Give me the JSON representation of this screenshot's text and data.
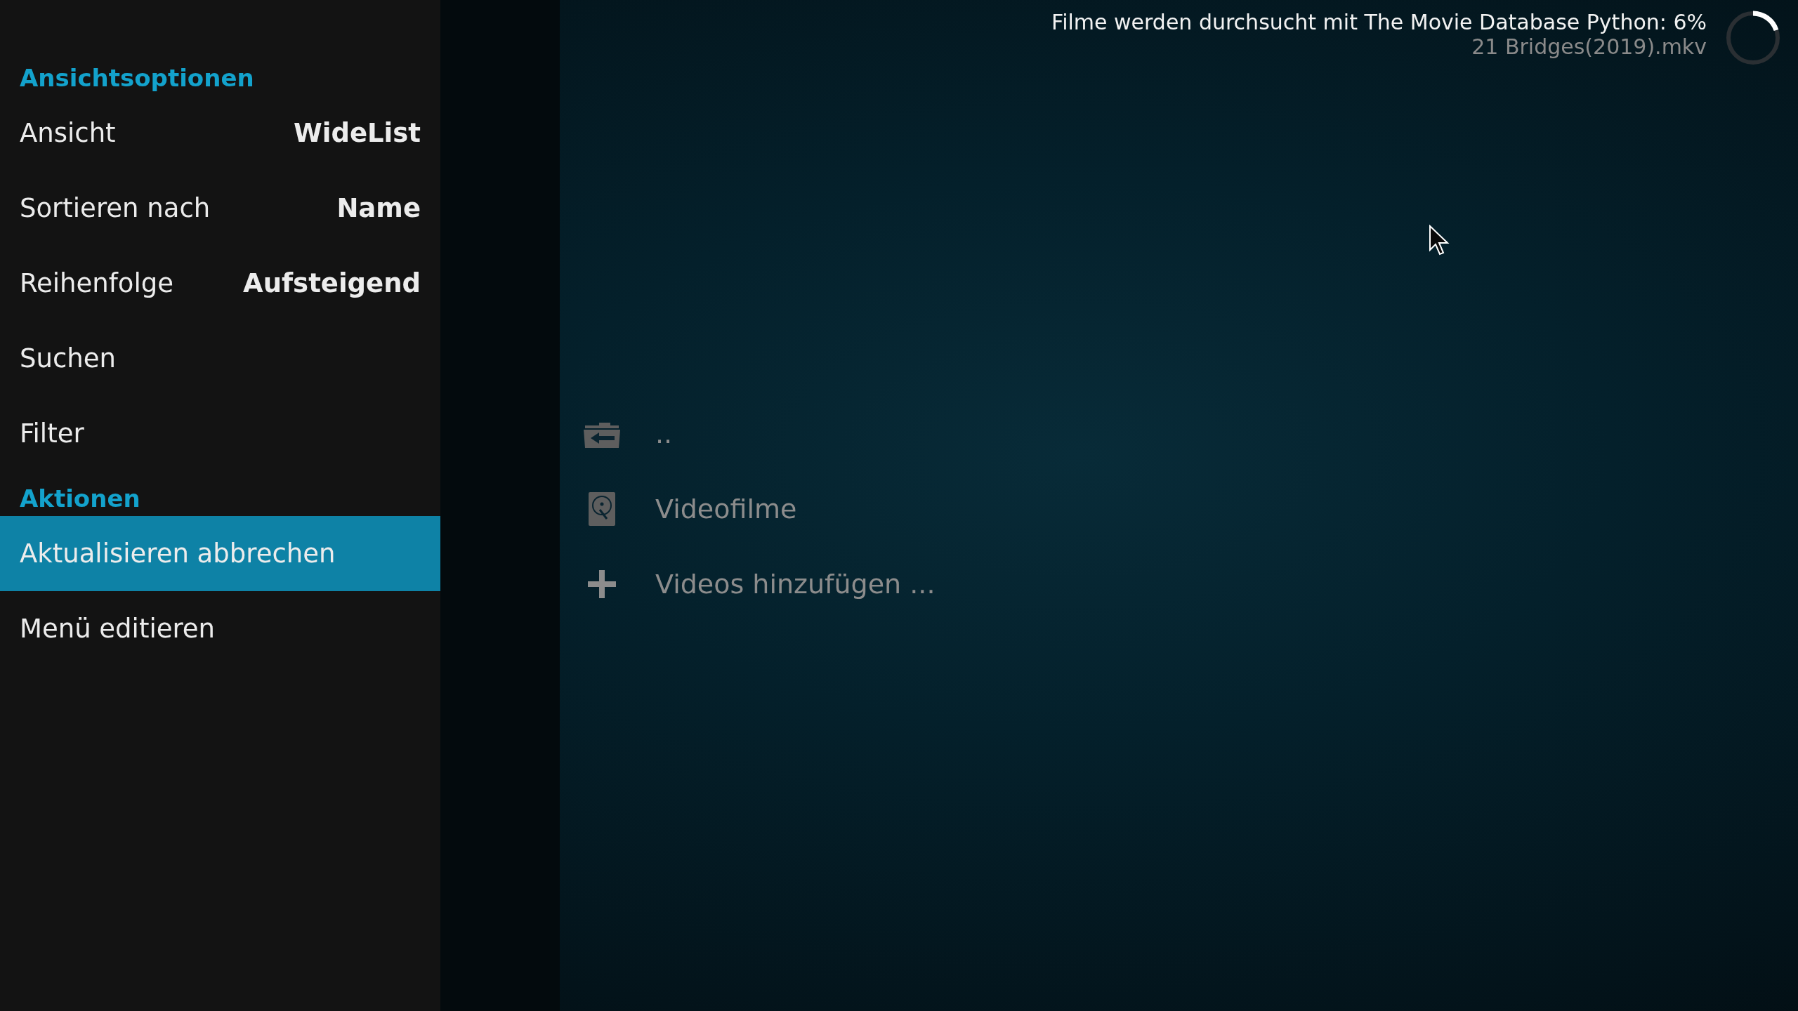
{
  "sidebar": {
    "sections": [
      {
        "title": "Ansichtsoptionen",
        "items": [
          {
            "kind": "option",
            "label": "Ansicht",
            "value": "WideList",
            "selected": false
          },
          {
            "kind": "option",
            "label": "Sortieren nach",
            "value": "Name",
            "selected": false
          },
          {
            "kind": "option",
            "label": "Reihenfolge",
            "value": "Aufsteigend",
            "selected": false
          },
          {
            "kind": "action",
            "label": "Suchen",
            "selected": false
          },
          {
            "kind": "action",
            "label": "Filter",
            "selected": false
          }
        ]
      },
      {
        "title": "Aktionen",
        "items": [
          {
            "kind": "action",
            "label": "Aktualisieren abbrechen",
            "selected": true
          },
          {
            "kind": "action",
            "label": "Menü editieren",
            "selected": false
          }
        ]
      }
    ]
  },
  "scan_status": {
    "title": "Filme werden durchsucht mit The Movie Database Python:  6%",
    "file": "21 Bridges(2019).mkv"
  },
  "file_list": [
    {
      "kind": "parent",
      "label": ".."
    },
    {
      "kind": "drive",
      "label": "Videofilme"
    },
    {
      "kind": "add",
      "label": "Videos hinzufügen ..."
    }
  ]
}
